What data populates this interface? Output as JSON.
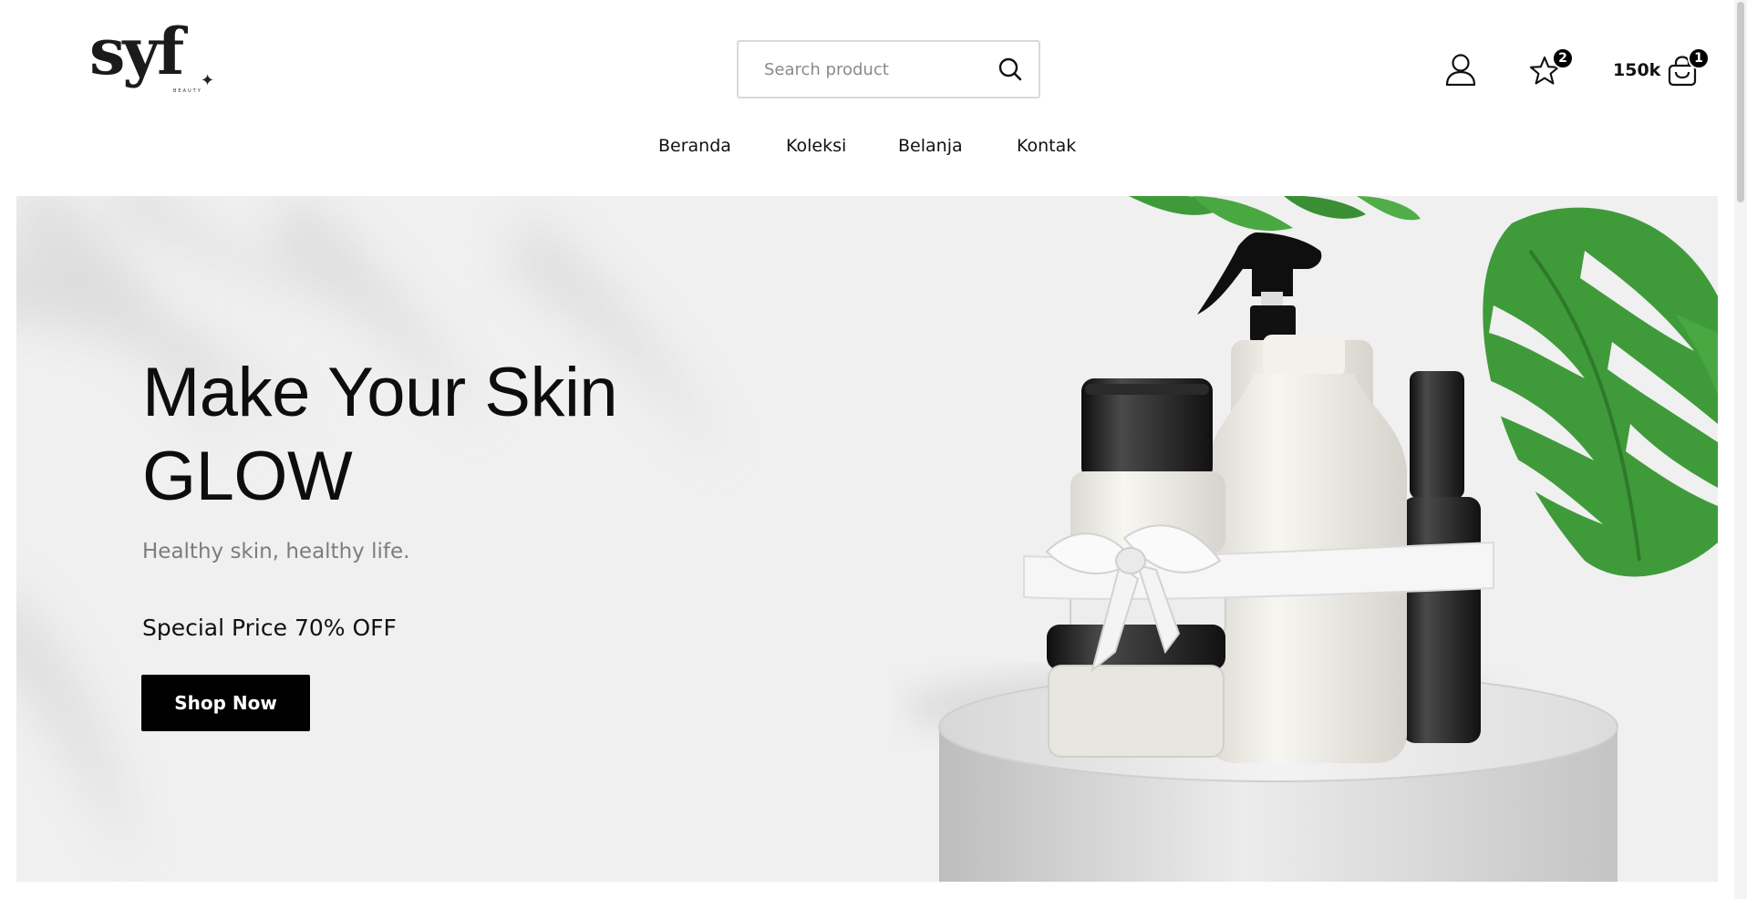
{
  "brand": {
    "logo_text": "syf",
    "logo_sub": "BEAUTY"
  },
  "search": {
    "placeholder": "Search product"
  },
  "nav": {
    "items": [
      {
        "label": "Beranda"
      },
      {
        "label": "Koleksi"
      },
      {
        "label": "Belanja"
      },
      {
        "label": "Kontak"
      }
    ]
  },
  "header_actions": {
    "account_icon": "user-icon",
    "wishlist_icon": "star-icon",
    "wishlist_count": "2",
    "cart_total": "150k",
    "cart_icon": "shopping-bag-icon",
    "cart_count": "1"
  },
  "hero": {
    "title_line1": "Make Your Skin",
    "title_line2": "GLOW",
    "subtitle": "Healthy skin, healthy life.",
    "offer": "Special Price 70% OFF",
    "cta_label": "Shop Now"
  },
  "colors": {
    "primary": "#000000",
    "hero_bg": "#f0f0f0",
    "leaf": "#3f9b3a",
    "muted_text": "#7d7d7d"
  }
}
